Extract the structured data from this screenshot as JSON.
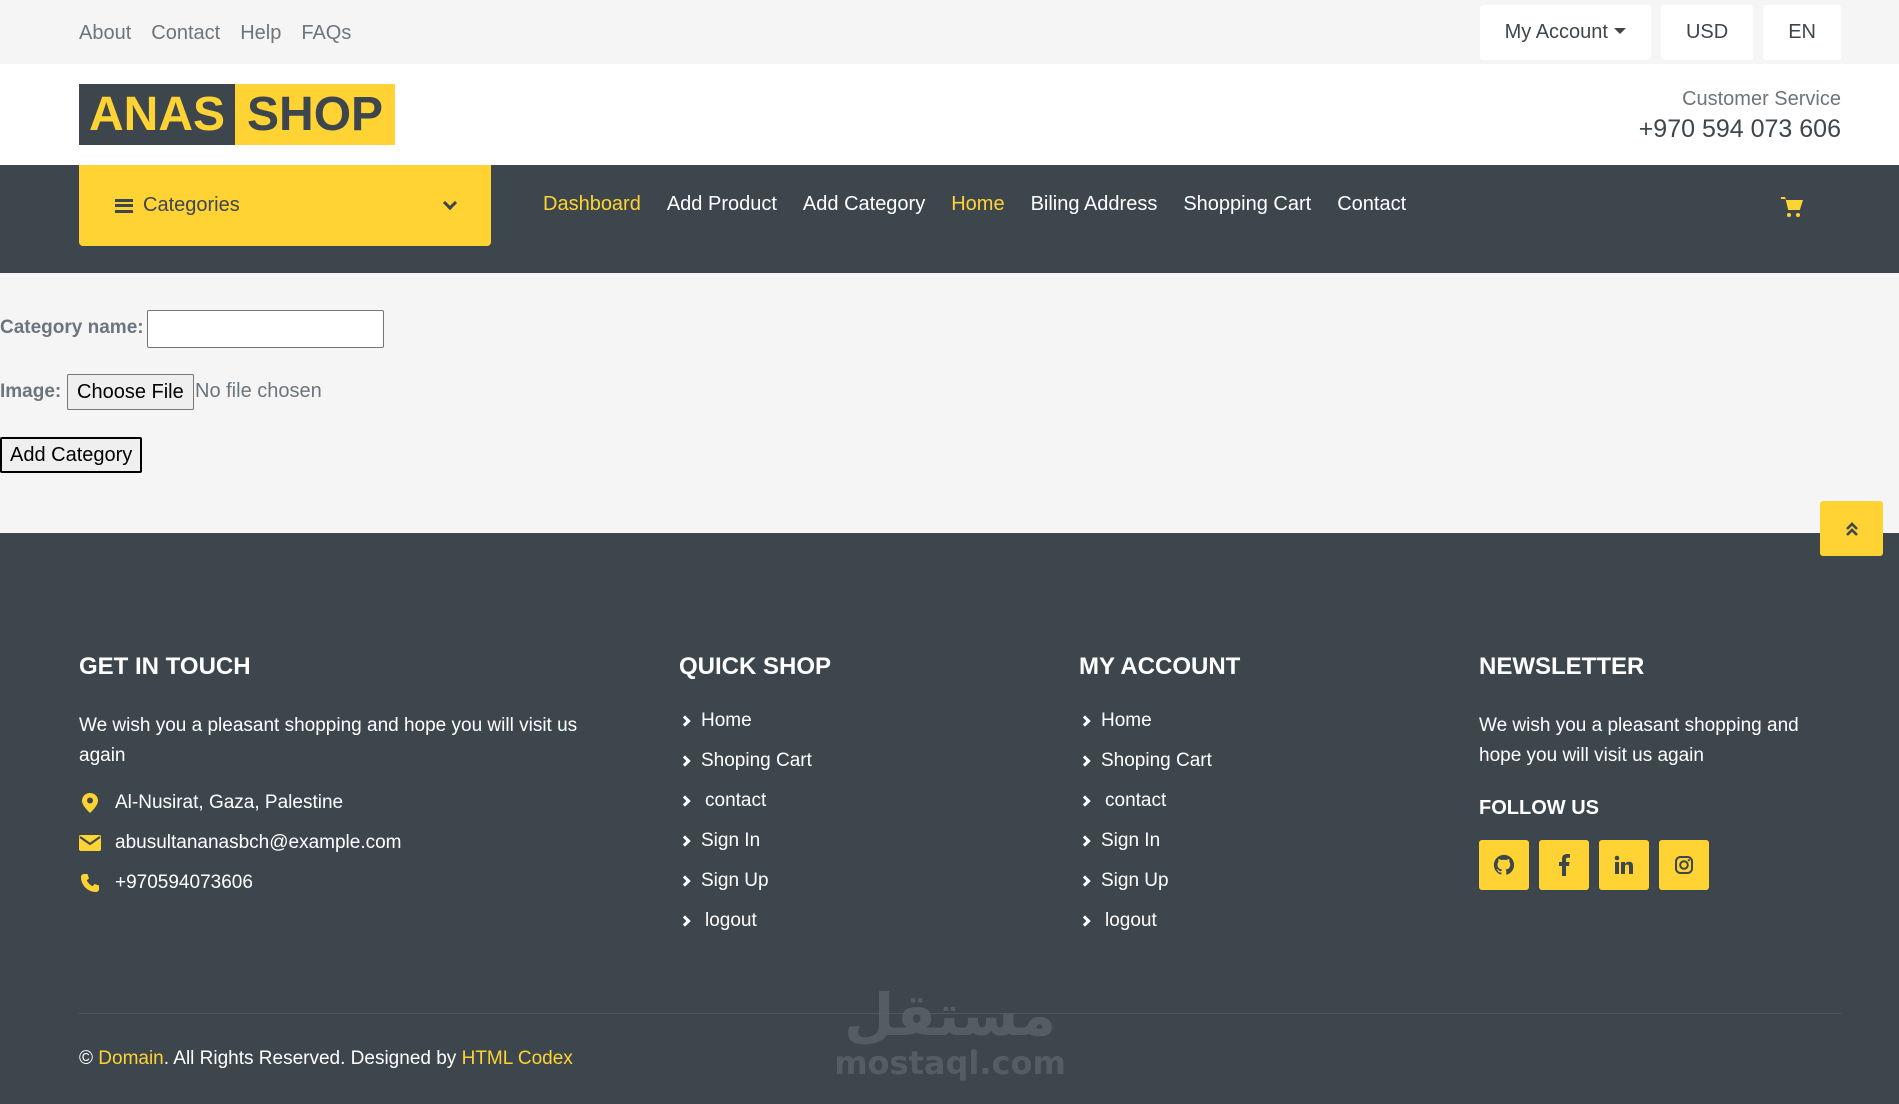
{
  "topbar": {
    "links": [
      "About",
      "Contact",
      "Help",
      "FAQs"
    ],
    "account_label": "My Account",
    "currency": "USD",
    "language": "EN"
  },
  "brand": {
    "logo_part1": "ANAS",
    "logo_part2": "SHOP",
    "customer_service_label": "Customer Service",
    "customer_service_phone": "+970 594 073 606"
  },
  "navbar": {
    "categories_label": "Categories",
    "items": [
      {
        "label": "Dashboard",
        "active": true
      },
      {
        "label": "Add Product",
        "active": false
      },
      {
        "label": "Add Category",
        "active": false
      },
      {
        "label": "Home",
        "active": true
      },
      {
        "label": "Biling Address",
        "active": false
      },
      {
        "label": "Shopping Cart",
        "active": false
      },
      {
        "label": "Contact",
        "active": false
      }
    ]
  },
  "form": {
    "category_label": "Category name:",
    "category_value": "",
    "image_label": "Image:",
    "file_button": "Choose File",
    "file_status": "No file chosen",
    "submit_label": "Add Category"
  },
  "footer": {
    "get_in_touch": {
      "title": "GET IN TOUCH",
      "text": "We wish you a pleasant shopping and hope you will visit us again",
      "address": "Al-Nusirat, Gaza, Palestine",
      "email": "abusultananasbch@example.com",
      "phone": "+970594073606"
    },
    "quick_shop": {
      "title": "QUICK SHOP",
      "links": [
        "Home",
        "Shoping Cart",
        "contact",
        "Sign In",
        "Sign Up",
        "logout"
      ]
    },
    "my_account": {
      "title": "MY ACCOUNT",
      "links": [
        "Home",
        "Shoping Cart",
        "contact",
        "Sign In",
        "Sign Up",
        "logout"
      ]
    },
    "newsletter": {
      "title": "NEWSLETTER",
      "text": "We wish you a pleasant shopping and hope you will visit us again",
      "follow_label": "FOLLOW US",
      "social_icons": [
        "github-icon",
        "facebook-icon",
        "linkedin-icon",
        "instagram-icon"
      ]
    },
    "copyright": {
      "prefix": "©",
      "domain": "Domain",
      "middle": ". All Rights Reserved. Designed by",
      "designer": "HTML Codex"
    }
  },
  "watermark": {
    "arabic": "مستقل",
    "latin": "mostaql.com"
  },
  "colors": {
    "accent": "#ffd333",
    "dark": "#3d464d",
    "light_bg": "#f5f5f5"
  }
}
